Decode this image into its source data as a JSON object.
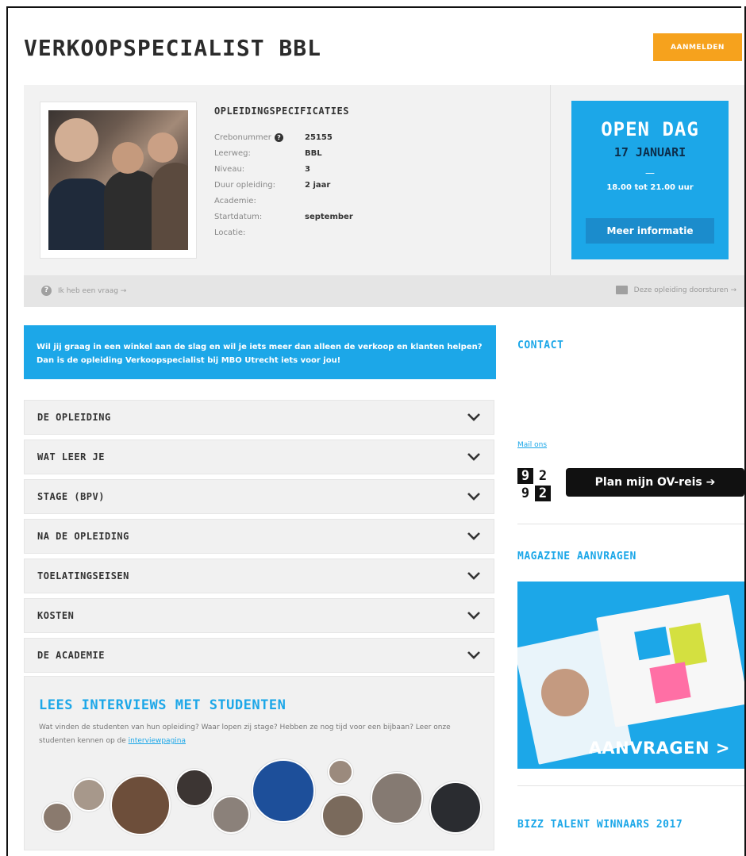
{
  "header": {
    "title": "VERKOOPSPECIALIST BBL",
    "signup_label": "AANMELDEN"
  },
  "specs": {
    "heading": "OPLEIDINGSPECIFICATIES",
    "rows": [
      {
        "label": "Crebonummer",
        "value": "25155",
        "info": true
      },
      {
        "label": "Leerweg:",
        "value": "BBL"
      },
      {
        "label": "Niveau:",
        "value": "3"
      },
      {
        "label": "Duur opleiding:",
        "value": "2 jaar"
      },
      {
        "label": "Academie:",
        "value": ""
      },
      {
        "label": "Startdatum:",
        "value": "september"
      },
      {
        "label": "Locatie:",
        "value": ""
      }
    ]
  },
  "open_day": {
    "title": "OPEN DAG",
    "date": "17 JANUARI",
    "dash": "—",
    "time": "18.00 tot 21.00 uur",
    "button": "Meer informatie"
  },
  "actions": {
    "question": "Ik heb een vraag →",
    "forward": "Deze opleiding doorsturen →"
  },
  "intro": "Wil jij graag in een winkel aan de slag en wil je iets meer dan alleen de verkoop en klanten helpen? Dan is de opleiding Verkoopspecialist bij MBO Utrecht iets voor jou!",
  "accordion": [
    "DE OPLEIDING",
    "WAT LEER JE",
    "STAGE (BPV)",
    "NA DE OPLEIDING",
    "TOELATINGSEISEN",
    "KOSTEN",
    "DE ACADEMIE"
  ],
  "interviews": {
    "title": "LEES INTERVIEWS MET STUDENTEN",
    "text": "Wat vinden de studenten van hun opleiding? Waar lopen zij stage? Hebben ze nog tijd voor een bijbaan? Leer onze studenten kennen op de ",
    "link": "interviewpagina"
  },
  "sidebar": {
    "contact_heading": "CONTACT",
    "mail_link": "Mail ons",
    "ov_logo_digits": [
      "9",
      "2",
      "9",
      "2"
    ],
    "ov_button": "Plan mijn OV-reis ➔",
    "magazine_heading": "MAGAZINE AANVRAGEN",
    "magazine_cta": "AANVRAGEN >",
    "bizz_heading": "BIZZ TALENT WINNAARS 2017"
  },
  "colors": {
    "accent_blue": "#1ca7e8",
    "signup_orange": "#f6a21d"
  }
}
